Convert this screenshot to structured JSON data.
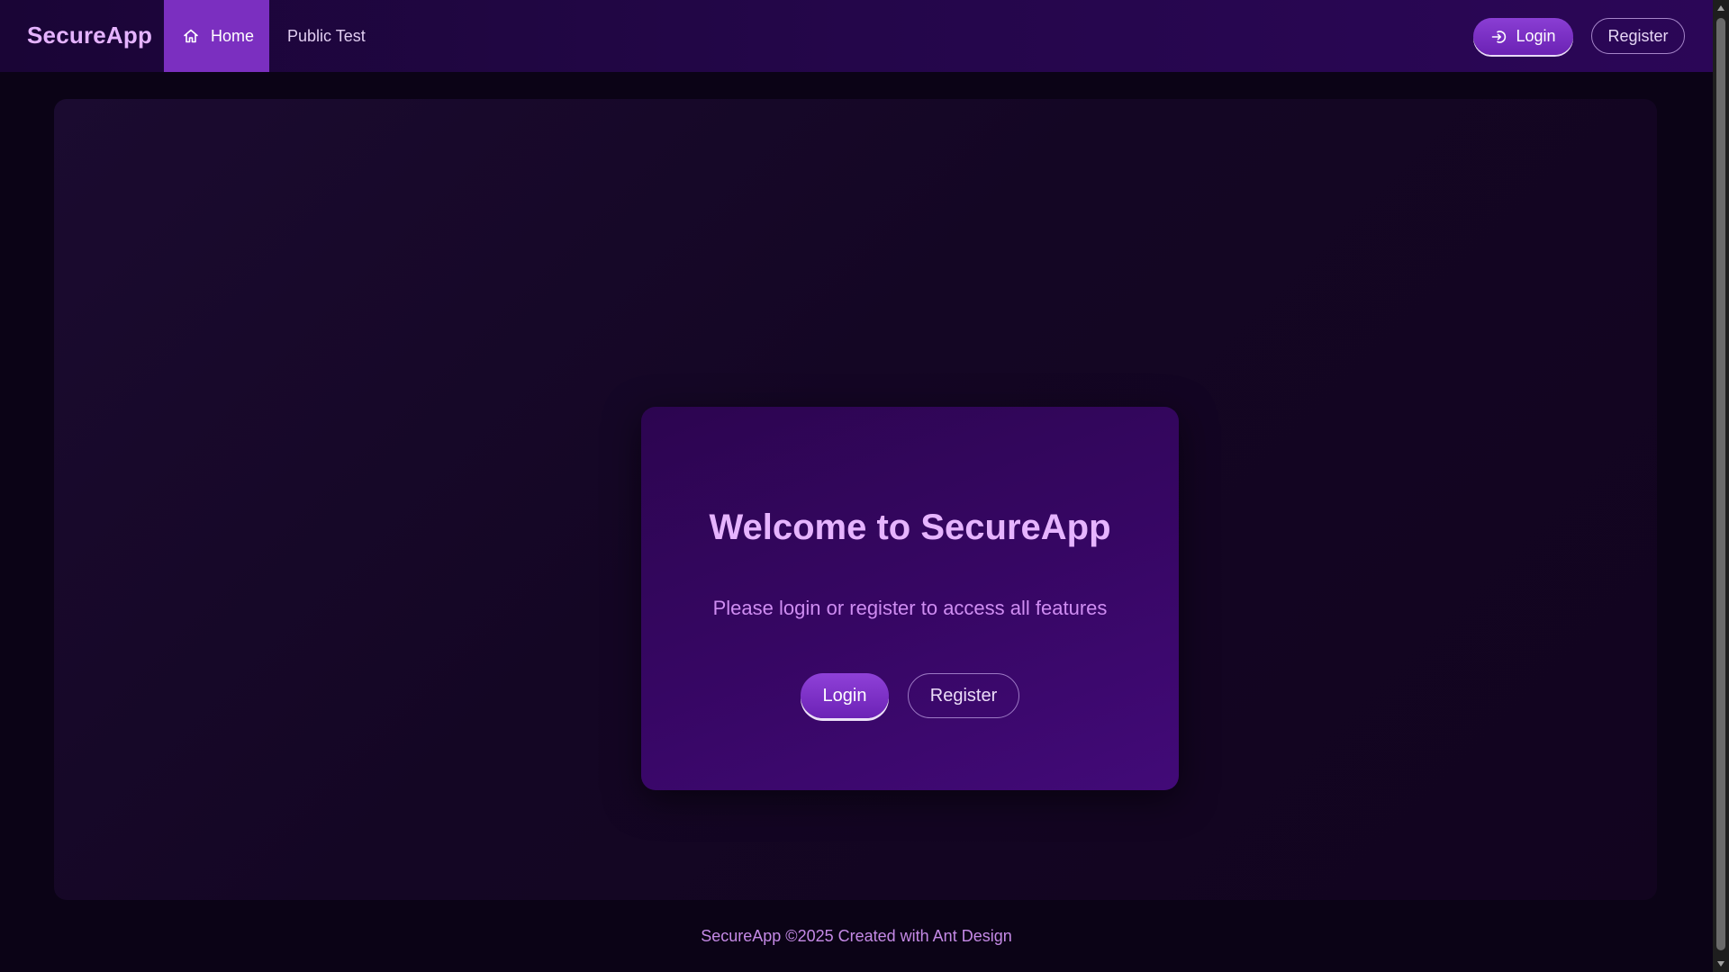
{
  "header": {
    "logo": "SecureApp",
    "nav": [
      {
        "label": "Home",
        "icon": "home-icon",
        "active": true
      },
      {
        "label": "Public Test",
        "active": false
      }
    ],
    "login_label": "Login",
    "login_icon": "login-icon",
    "register_label": "Register"
  },
  "welcome": {
    "title": "Welcome to SecureApp",
    "subtitle": "Please login or register to access all features",
    "login_label": "Login",
    "register_label": "Register"
  },
  "footer": {
    "text": "SecureApp ©2025 Created with Ant Design"
  },
  "colors": {
    "accent": "#7b2fc0",
    "title": "#e6b4ff",
    "background": "#0b0316"
  }
}
